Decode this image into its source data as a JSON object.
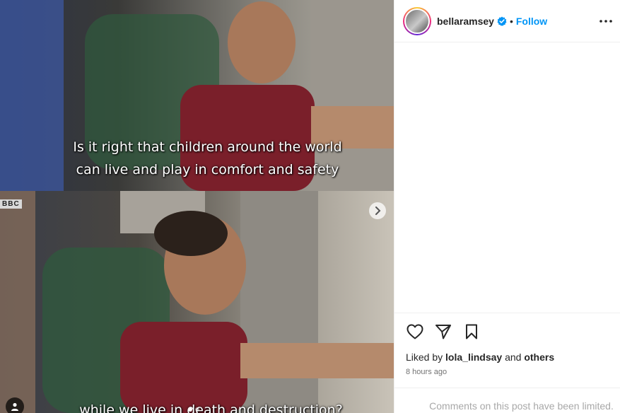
{
  "post": {
    "subtitles": [
      "Is it right that children around the world",
      "can live and play in comfort and safety",
      "while we live in death and destruction?"
    ],
    "watermark": "BBC",
    "carousel": {
      "total": 2,
      "current": 1
    }
  },
  "header": {
    "username": "bellaramsey",
    "verified": true,
    "separator": "•",
    "follow_label": "Follow",
    "more_icon": "more-horizontal-icon"
  },
  "actions": {
    "like_icon": "heart-icon",
    "share_icon": "paper-plane-icon",
    "save_icon": "bookmark-icon"
  },
  "likes": {
    "prefix": "Liked by",
    "user": "lola_lindsay",
    "middle": "and",
    "suffix": "others"
  },
  "timestamp": "8 hours ago",
  "comments_notice": "Comments on this post have been limited.",
  "colors": {
    "accent": "#0095f6",
    "text": "#262626",
    "muted": "#737373",
    "verified": "#0095f6"
  }
}
